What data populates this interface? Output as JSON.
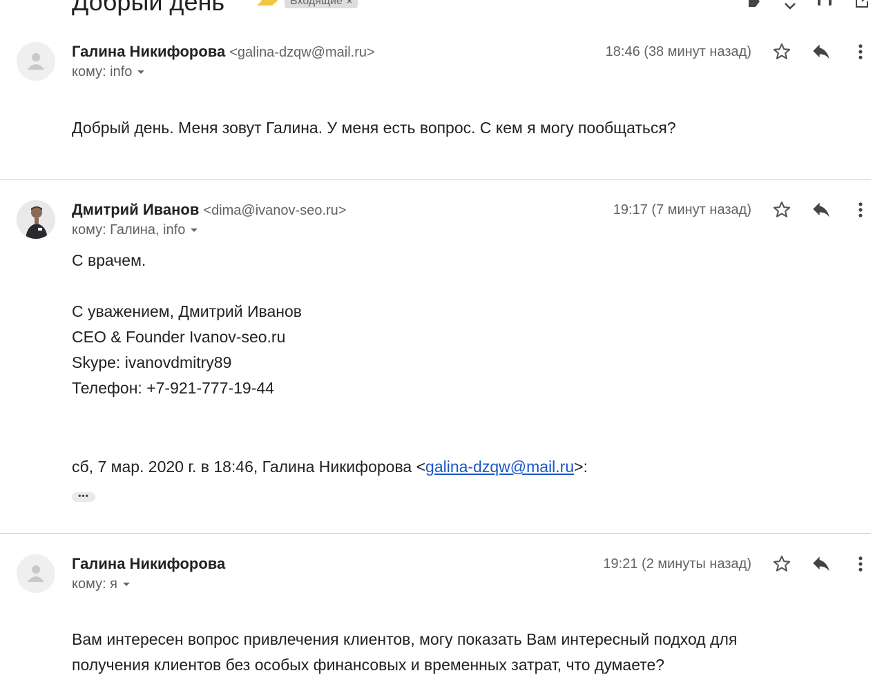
{
  "header": {
    "subject": "Добрый день",
    "label": "Входящие",
    "label_remove": "×"
  },
  "messages": [
    {
      "sender_name": "Галина Никифорова",
      "sender_email": "<galina-dzqw@mail.ru>",
      "to": "кому: info",
      "timestamp": "18:46 (38 минут назад)",
      "body": [
        "Добрый день. Меня зовут Галина. У меня есть вопрос. С кем я могу пообщаться?"
      ]
    },
    {
      "sender_name": "Дмитрий Иванов",
      "sender_email": "<dima@ivanov-seo.ru>",
      "to": "кому: Галина, info",
      "timestamp": "19:17 (7 минут назад)",
      "body": [
        "С врачем.",
        "С уважением, Дмитрий Иванов",
        "CEO & Founder Ivanov-seo.ru",
        "Skype: ivanovdmitry89",
        "Телефон: +7-921-777-19-44"
      ],
      "quote_prefix": "сб, 7 мар. 2020 г. в 18:46, Галина Никифорова <",
      "quote_link": "galina-dzqw@mail.ru",
      "quote_suffix": ">:",
      "expand_label": "•••"
    },
    {
      "sender_name": "Галина Никифорова",
      "sender_email": "",
      "to": "кому: я",
      "timestamp": "19:21 (2 минуты назад)",
      "body": [
        "Вам интересен вопрос привлечения клиентов, могу показать Вам интересный подход для",
        "получения клиентов без особых финансовых и временных затрат, что думаете?"
      ]
    }
  ],
  "icons": {
    "star": "star-icon",
    "reply": "reply-icon",
    "more": "more-vert-icon",
    "avatar_default": "person-icon"
  }
}
